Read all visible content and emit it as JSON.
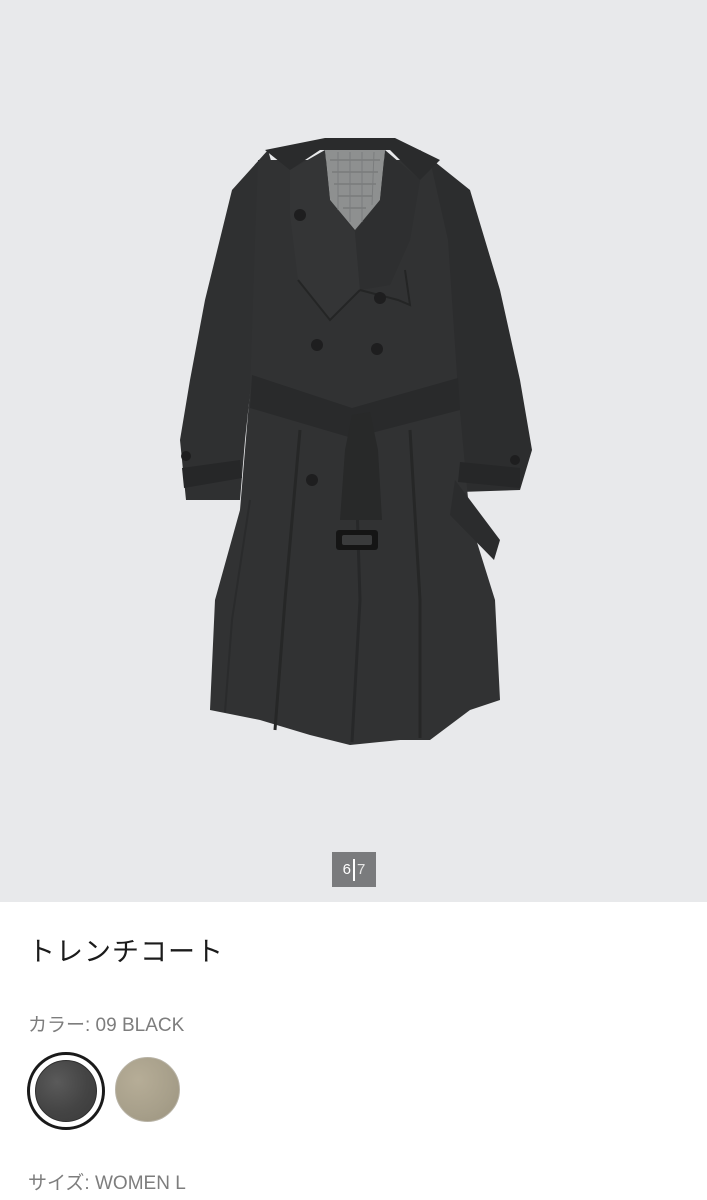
{
  "gallery": {
    "current_page": "6",
    "total_pages": "7",
    "image_name": "trench-coat-black"
  },
  "product": {
    "name": "トレンチコート"
  },
  "color": {
    "label": "カラー: 09 BLACK",
    "options": [
      {
        "name": "09 BLACK",
        "hex": "#444444",
        "selected": true
      },
      {
        "name": "beige",
        "hex": "#a79f8a",
        "selected": false
      }
    ]
  },
  "size": {
    "label": "サイズ: WOMEN L"
  }
}
